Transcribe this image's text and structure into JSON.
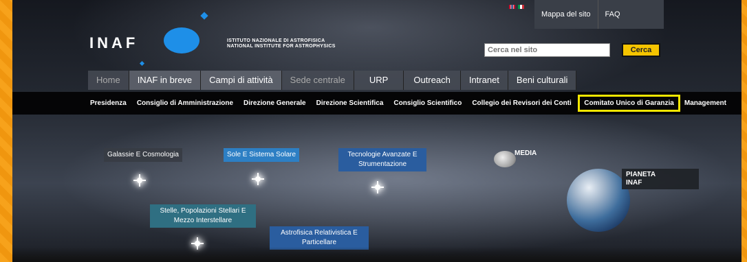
{
  "header": {
    "logo_text": "INAF",
    "institute_line1": "ISTITUTO NAZIONALE DI ASTROFISICA",
    "institute_line2": "NATIONAL INSTITUTE FOR ASTROPHYSICS",
    "top_links": [
      "Mappa del sito",
      "FAQ"
    ],
    "search": {
      "placeholder": "Cerca nel sito",
      "button": "Cerca"
    }
  },
  "main_nav": [
    {
      "label": "Home"
    },
    {
      "label": "INAF in breve"
    },
    {
      "label": "Campi di attività"
    },
    {
      "label": "Sede centrale"
    },
    {
      "label": "URP"
    },
    {
      "label": "Outreach"
    },
    {
      "label": "Intranet"
    },
    {
      "label": "Beni culturali"
    }
  ],
  "sub_nav": [
    "Presidenza",
    "Consiglio di Amministrazione",
    "Direzione Generale",
    "Direzione Scientifica",
    "Consiglio Scientifico",
    "Collegio dei Revisori dei Conti",
    "Comitato Unico di Garanzia",
    "Management"
  ],
  "content": {
    "galassie": "Galassie E Cosmologia",
    "sole": "Sole E Sistema Solare",
    "tecnologie_1": "Tecnologie Avanzate E",
    "tecnologie_2": "Strumentazione",
    "stelle_1": "Stelle, Popolazioni Stellari E",
    "stelle_2": "Mezzo Interstellare",
    "astrofisica_1": "Astrofisica Relativistica E",
    "astrofisica_2": "Particellare",
    "media": "MEDIA",
    "pianeta_1": "PIANETA",
    "pianeta_2": "INAF"
  },
  "colors": {
    "accent": "#1e8fe8",
    "search_button": "#f5c400",
    "highlight": "#f5e700",
    "frame": "#f5a623"
  }
}
